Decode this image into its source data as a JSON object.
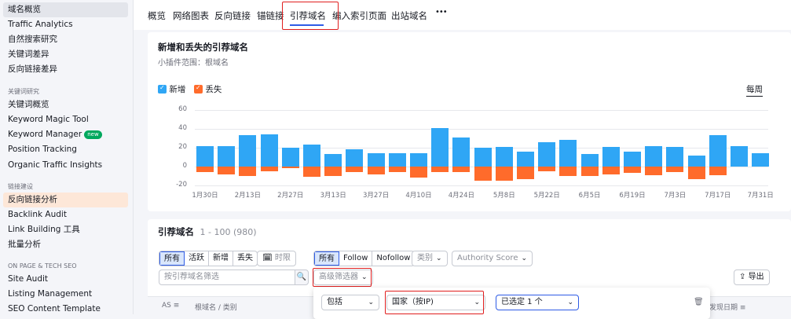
{
  "sidebar": {
    "items_top": [
      "域名概览",
      "Traffic Analytics",
      "自然搜索研究",
      "关键词差异",
      "反向链接差异"
    ],
    "group_keyword": "关键词研究",
    "items_keyword": [
      "关键词概览",
      "Keyword Magic Tool",
      "Keyword Manager",
      "Position Tracking",
      "Organic Traffic Insights"
    ],
    "new_badge": "new",
    "group_link": "链接建设",
    "items_link": [
      "反向链接分析",
      "Backlink Audit",
      "Link Building 工具",
      "批量分析"
    ],
    "group_seo": "ON PAGE & TECH SEO",
    "items_seo": [
      "Site Audit",
      "Listing Management",
      "SEO Content Template"
    ]
  },
  "topnav": {
    "tabs": [
      "概览",
      "网络图表",
      "反向链接",
      "锚链接",
      "引荐域名",
      "编入索引页面",
      "出站域名"
    ],
    "more": "•••"
  },
  "chart_card": {
    "title": "新增和丢失的引荐域名",
    "subtitle": "小插件范围：根域名",
    "legend_new": "新增",
    "legend_lost": "丢失",
    "period_toggle": "每周"
  },
  "chart_data": {
    "type": "bar",
    "title": "新增和丢失的引荐域名",
    "colors": {
      "new": "#2fa6f5",
      "lost": "#ff6b2b"
    },
    "ylim": [
      -20,
      60
    ],
    "yticks": [
      "60",
      "40",
      "20",
      "0",
      "-20"
    ],
    "xticks": [
      "1月30日",
      "2月13日",
      "2月27日",
      "3月13日",
      "3月27日",
      "4月10日",
      "4月24日",
      "5月8日",
      "5月22日",
      "6月5日",
      "6月19日",
      "7月3日",
      "7月17日",
      "7月31日"
    ],
    "series": [
      {
        "name": "新增",
        "values": [
          22,
          22,
          33,
          34,
          20,
          23,
          13,
          18,
          14,
          14,
          14,
          41,
          31,
          20,
          21,
          16,
          26,
          28,
          13,
          21,
          16,
          22,
          21,
          12,
          33,
          22,
          14
        ]
      },
      {
        "name": "丢失",
        "values": [
          -6,
          -8,
          -10,
          -5,
          -2,
          -11,
          -10,
          -6,
          -8,
          -6,
          -12,
          -6,
          -6,
          -15,
          -15,
          -13,
          -5,
          -10,
          -10,
          -8,
          -7,
          -9,
          -6,
          -13,
          -9,
          0,
          0
        ]
      }
    ]
  },
  "ref_card": {
    "title": "引荐域名",
    "range": "1 - 100 (980)",
    "filter1": [
      "所有",
      "活跃",
      "新增",
      "丢失"
    ],
    "time_btn": "时限",
    "filter2": [
      "所有",
      "Follow",
      "Nofollow"
    ],
    "category": "类别",
    "authority": "Authority Score",
    "search_placeholder": "按引荐域名筛选",
    "advanced": "高级筛选器",
    "export": "导出"
  },
  "popup": {
    "include": "包括",
    "country": "国家（按IP)",
    "selected": "已选定 1 个"
  },
  "table": {
    "headers": [
      "AS",
      "根域名 / 类别",
      "发现日期"
    ]
  }
}
